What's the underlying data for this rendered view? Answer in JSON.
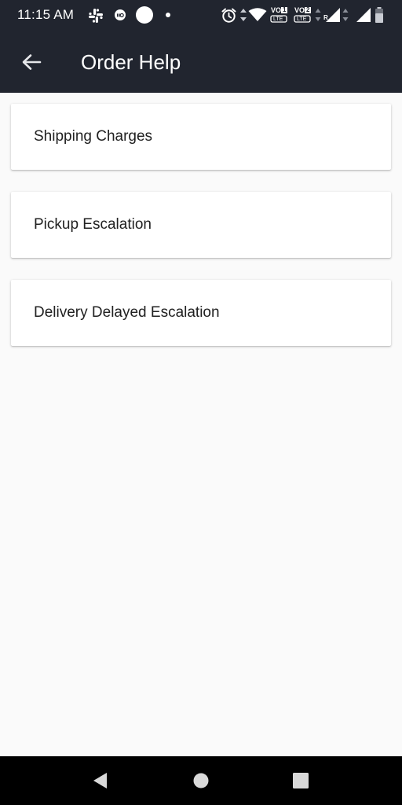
{
  "status_bar": {
    "time": "11:15 AM",
    "left_icons": [
      "slack-icon",
      "jio-icon",
      "circle-icon",
      "dot-icon"
    ],
    "right_icons": [
      "alarm-icon",
      "data-arrows-icon",
      "wifi-icon",
      "volte1-icon",
      "volte2-icon",
      "signal-roaming-icon",
      "signal-icon",
      "battery-icon"
    ],
    "volte_label": "VO",
    "lte_label": "LTE",
    "sim1_label": "1",
    "sim2_label": "2",
    "roaming_label": "R"
  },
  "app_bar": {
    "title": "Order Help",
    "back_icon": "arrow-back-icon"
  },
  "help_items": [
    {
      "label": "Shipping Charges"
    },
    {
      "label": "Pickup Escalation"
    },
    {
      "label": "Delivery Delayed Escalation"
    }
  ],
  "nav_bar": {
    "icons": [
      "back-triangle-icon",
      "home-circle-icon",
      "recents-square-icon"
    ]
  },
  "colors": {
    "app_bar_bg": "#21252f",
    "page_bg": "#fafafa",
    "card_bg": "#ffffff",
    "text": "#212121",
    "nav_bar_bg": "#000000"
  }
}
